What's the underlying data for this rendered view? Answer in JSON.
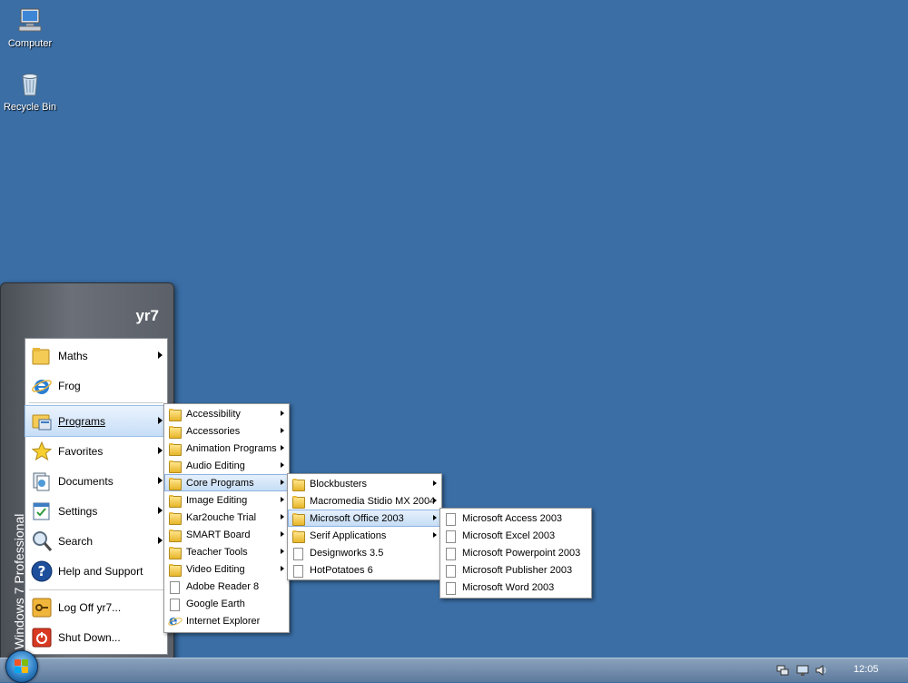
{
  "desktop": {
    "icons": [
      {
        "label": "Computer",
        "icon": "computer-icon"
      },
      {
        "label": "Recycle Bin",
        "icon": "recycle-bin-icon"
      }
    ]
  },
  "start_menu": {
    "user": "yr7",
    "side_banner": "Windows 7 Professional",
    "items": [
      {
        "label": "Maths",
        "icon": "folder-icon",
        "submenu": true
      },
      {
        "label": "Frog",
        "icon": "internet-explorer-icon",
        "submenu": false
      },
      {
        "label": "Programs",
        "icon": "programs-icon",
        "submenu": true,
        "highlighted": true
      },
      {
        "label": "Favorites",
        "icon": "star-icon",
        "submenu": true
      },
      {
        "label": "Documents",
        "icon": "documents-icon",
        "submenu": true
      },
      {
        "label": "Settings",
        "icon": "settings-icon",
        "submenu": true
      },
      {
        "label": "Search",
        "icon": "magnifier-icon",
        "submenu": true
      },
      {
        "label": "Help and Support",
        "icon": "help-icon",
        "submenu": false
      },
      {
        "label": "Log Off yr7...",
        "icon": "key-icon",
        "submenu": false
      },
      {
        "label": "Shut Down...",
        "icon": "power-icon",
        "submenu": false
      }
    ]
  },
  "programs_menu": [
    {
      "label": "Accessibility",
      "type": "folder",
      "submenu": true
    },
    {
      "label": "Accessories",
      "type": "folder",
      "submenu": true
    },
    {
      "label": "Animation Programs",
      "type": "folder",
      "submenu": true
    },
    {
      "label": "Audio Editing",
      "type": "folder",
      "submenu": true
    },
    {
      "label": "Core Programs",
      "type": "folder",
      "submenu": true,
      "highlighted": true
    },
    {
      "label": "Image Editing",
      "type": "folder",
      "submenu": true
    },
    {
      "label": "Kar2ouche Trial",
      "type": "folder",
      "submenu": true
    },
    {
      "label": "SMART Board",
      "type": "folder",
      "submenu": true
    },
    {
      "label": "Teacher Tools",
      "type": "folder",
      "submenu": true
    },
    {
      "label": "Video Editing",
      "type": "folder",
      "submenu": true
    },
    {
      "label": "Adobe Reader 8",
      "type": "doc",
      "submenu": false
    },
    {
      "label": "Google Earth",
      "type": "doc",
      "submenu": false
    },
    {
      "label": "Internet Explorer",
      "type": "ie",
      "submenu": false
    }
  ],
  "core_programs_menu": [
    {
      "label": "Blockbusters",
      "type": "folder",
      "submenu": true
    },
    {
      "label": "Macromedia Stidio MX 2004",
      "type": "folder",
      "submenu": true
    },
    {
      "label": "Microsoft Office 2003",
      "type": "folder",
      "submenu": true,
      "highlighted": true
    },
    {
      "label": "Serif Applications",
      "type": "folder",
      "submenu": true
    },
    {
      "label": "Designworks 3.5",
      "type": "doc",
      "submenu": false
    },
    {
      "label": "HotPotatoes 6",
      "type": "doc",
      "submenu": false
    }
  ],
  "office_menu": [
    {
      "label": "Microsoft Access 2003",
      "type": "doc"
    },
    {
      "label": "Microsoft Excel 2003",
      "type": "doc"
    },
    {
      "label": "Microsoft Powerpoint 2003",
      "type": "doc"
    },
    {
      "label": "Microsoft Publisher 2003",
      "type": "doc"
    },
    {
      "label": "Microsoft Word 2003",
      "type": "doc"
    }
  ],
  "taskbar": {
    "clock": "12:05",
    "tray_icons": [
      "network-icon",
      "display-icon",
      "volume-icon"
    ]
  },
  "colors": {
    "desktop": "#3a6ea5",
    "highlight": "#c7def7"
  }
}
